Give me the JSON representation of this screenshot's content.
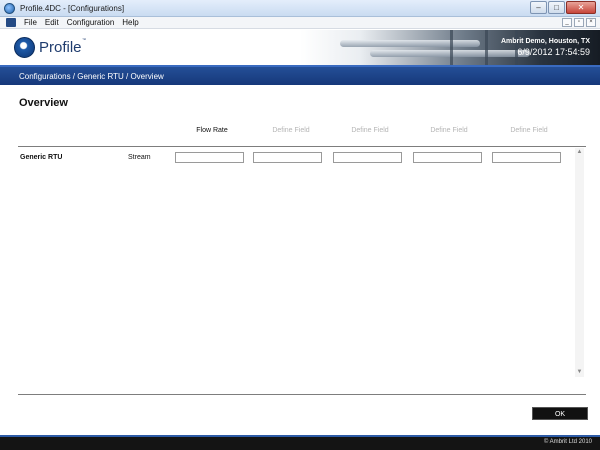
{
  "window": {
    "title": "Profile.4DC - [Configurations]",
    "controls": {
      "minimize": "–",
      "maximize": "□",
      "close": "✕"
    }
  },
  "menu": {
    "items": [
      "File",
      "Edit",
      "Configuration",
      "Help"
    ],
    "mdi_controls": {
      "minimize": "_",
      "restore": "▫",
      "close": "×"
    }
  },
  "header": {
    "logo_text": "Profile",
    "logo_tm": "™",
    "site": "Ambrit Demo, Houston, TX",
    "datetime": "6/9/2012   17:54:59"
  },
  "breadcrumb": {
    "text": "Configurations / Generic RTU / Overview"
  },
  "overview": {
    "title": "Overview",
    "columns": [
      "Flow Rate",
      "Define Field",
      "Define Field",
      "Define Field",
      "Define Field"
    ],
    "rows": [
      {
        "label": "Generic RTU",
        "sublabel": "Stream",
        "values": [
          "",
          "",
          "",
          "",
          ""
        ]
      }
    ]
  },
  "scrollbar": {
    "up": "▲",
    "down": "▼"
  },
  "ok_label": "OK",
  "footer": {
    "copyright": "© Ambrit Ltd 2010"
  },
  "colors": {
    "breadcrumb_bg": "#1e4a90",
    "footer_bg": "#141414",
    "muted_header": "#b5b5b5"
  },
  "icons": [
    "app-icon",
    "profile-logo-icon",
    "scroll-up-icon",
    "scroll-down-icon"
  ]
}
